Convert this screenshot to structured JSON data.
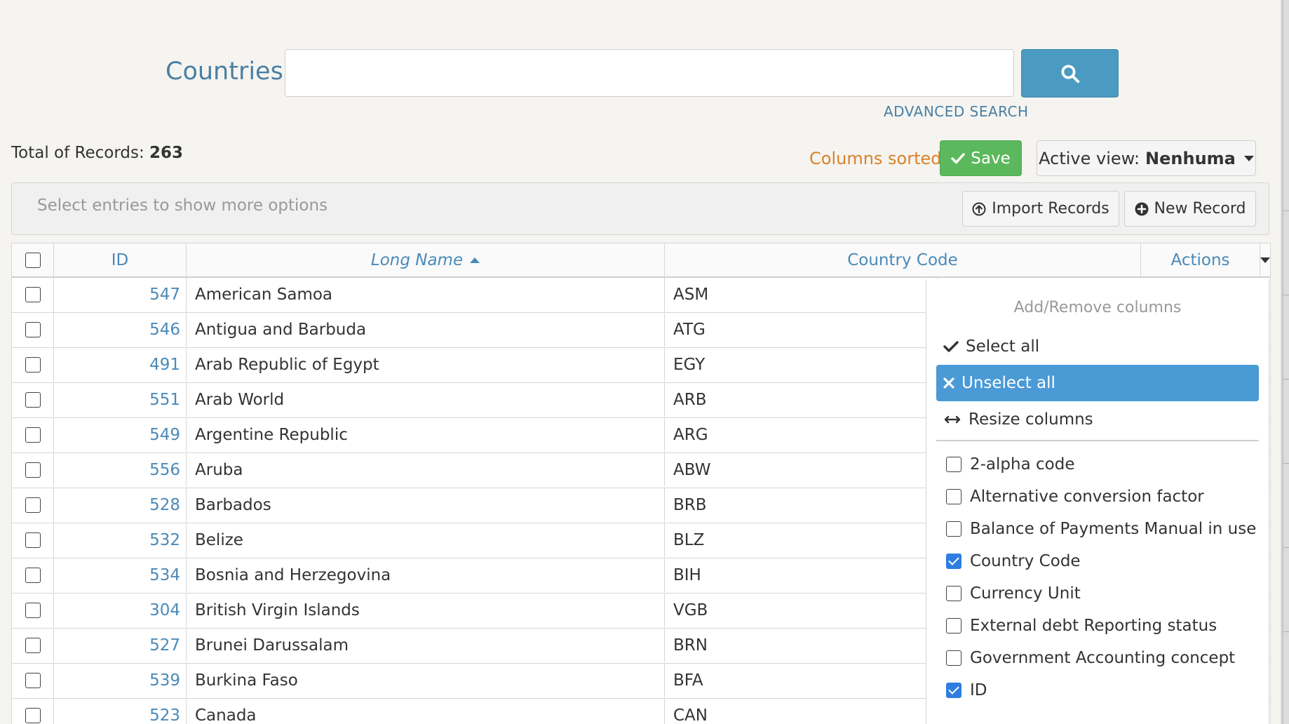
{
  "header": {
    "title": "Countries",
    "search_placeholder": "",
    "advanced_search_label": "ADVANCED SEARCH"
  },
  "summary": {
    "total_label": "Total of Records:",
    "total_value": "263",
    "columns_sorted_label": "Columns sorted",
    "save_label": "Save",
    "active_view_label": "Active view:",
    "active_view_value": "Nenhuma"
  },
  "toolbar": {
    "hint": "Select entries to show more options",
    "import_label": "Import Records",
    "new_label": "New Record"
  },
  "table": {
    "columns": {
      "id": "ID",
      "long_name": "Long Name",
      "country_code": "Country Code",
      "actions": "Actions"
    },
    "rows": [
      {
        "id": "547",
        "name": "American Samoa",
        "code": "ASM"
      },
      {
        "id": "546",
        "name": "Antigua and Barbuda",
        "code": "ATG"
      },
      {
        "id": "491",
        "name": "Arab Republic of Egypt",
        "code": "EGY"
      },
      {
        "id": "551",
        "name": "Arab World",
        "code": "ARB"
      },
      {
        "id": "549",
        "name": "Argentine Republic",
        "code": "ARG"
      },
      {
        "id": "556",
        "name": "Aruba",
        "code": "ABW"
      },
      {
        "id": "528",
        "name": "Barbados",
        "code": "BRB"
      },
      {
        "id": "532",
        "name": "Belize",
        "code": "BLZ"
      },
      {
        "id": "534",
        "name": "Bosnia and Herzegovina",
        "code": "BIH"
      },
      {
        "id": "304",
        "name": "British Virgin Islands",
        "code": "VGB"
      },
      {
        "id": "527",
        "name": "Brunei Darussalam",
        "code": "BRN"
      },
      {
        "id": "539",
        "name": "Burkina Faso",
        "code": "BFA"
      },
      {
        "id": "523",
        "name": "Canada",
        "code": "CAN"
      }
    ]
  },
  "column_menu": {
    "heading": "Add/Remove columns",
    "select_all": "Select all",
    "unselect_all": "Unselect all",
    "resize": "Resize columns",
    "columns": [
      {
        "label": "2-alpha code",
        "checked": false
      },
      {
        "label": "Alternative conversion factor",
        "checked": false
      },
      {
        "label": "Balance of Payments Manual in use",
        "checked": false
      },
      {
        "label": "Country Code",
        "checked": true
      },
      {
        "label": "Currency Unit",
        "checked": false
      },
      {
        "label": "External debt Reporting status",
        "checked": false
      },
      {
        "label": "Government Accounting concept",
        "checked": false
      },
      {
        "label": "ID",
        "checked": true
      }
    ]
  },
  "colors": {
    "accent": "#4a7fa4",
    "link": "#4a8ab8",
    "save_green": "#5cb85c",
    "sorted_orange": "#d9822b",
    "highlight": "#4a9ad6"
  }
}
